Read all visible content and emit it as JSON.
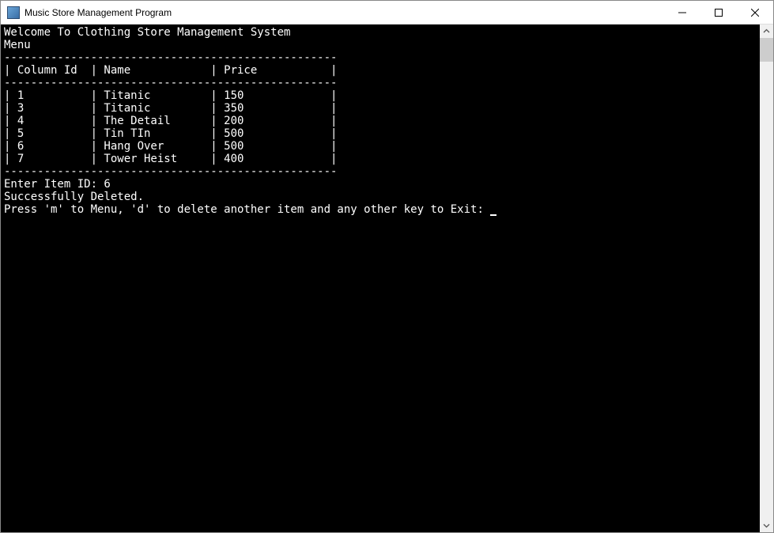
{
  "window": {
    "title": "Music Store Management Program"
  },
  "console": {
    "welcome": "Welcome To Clothing Store Management System",
    "menu_label": "Menu",
    "table": {
      "headers": {
        "col1": "Column Id",
        "col2": "Name",
        "col3": "Price"
      },
      "rows": [
        {
          "id": "1",
          "name": "Titanic",
          "price": "150"
        },
        {
          "id": "3",
          "name": "Titanic",
          "price": "350"
        },
        {
          "id": "4",
          "name": "The Detail",
          "price": "200"
        },
        {
          "id": "5",
          "name": "Tin TIn",
          "price": "500"
        },
        {
          "id": "6",
          "name": "Hang Over",
          "price": "500"
        },
        {
          "id": "7",
          "name": "Tower Heist",
          "price": "400"
        }
      ]
    },
    "prompt_item_id_label": "Enter Item ID: ",
    "prompt_item_id_value": "6",
    "status": "Successfully Deleted.",
    "footer_prompt": "Press 'm' to Menu, 'd' to delete another item and any other key to Exit: "
  }
}
